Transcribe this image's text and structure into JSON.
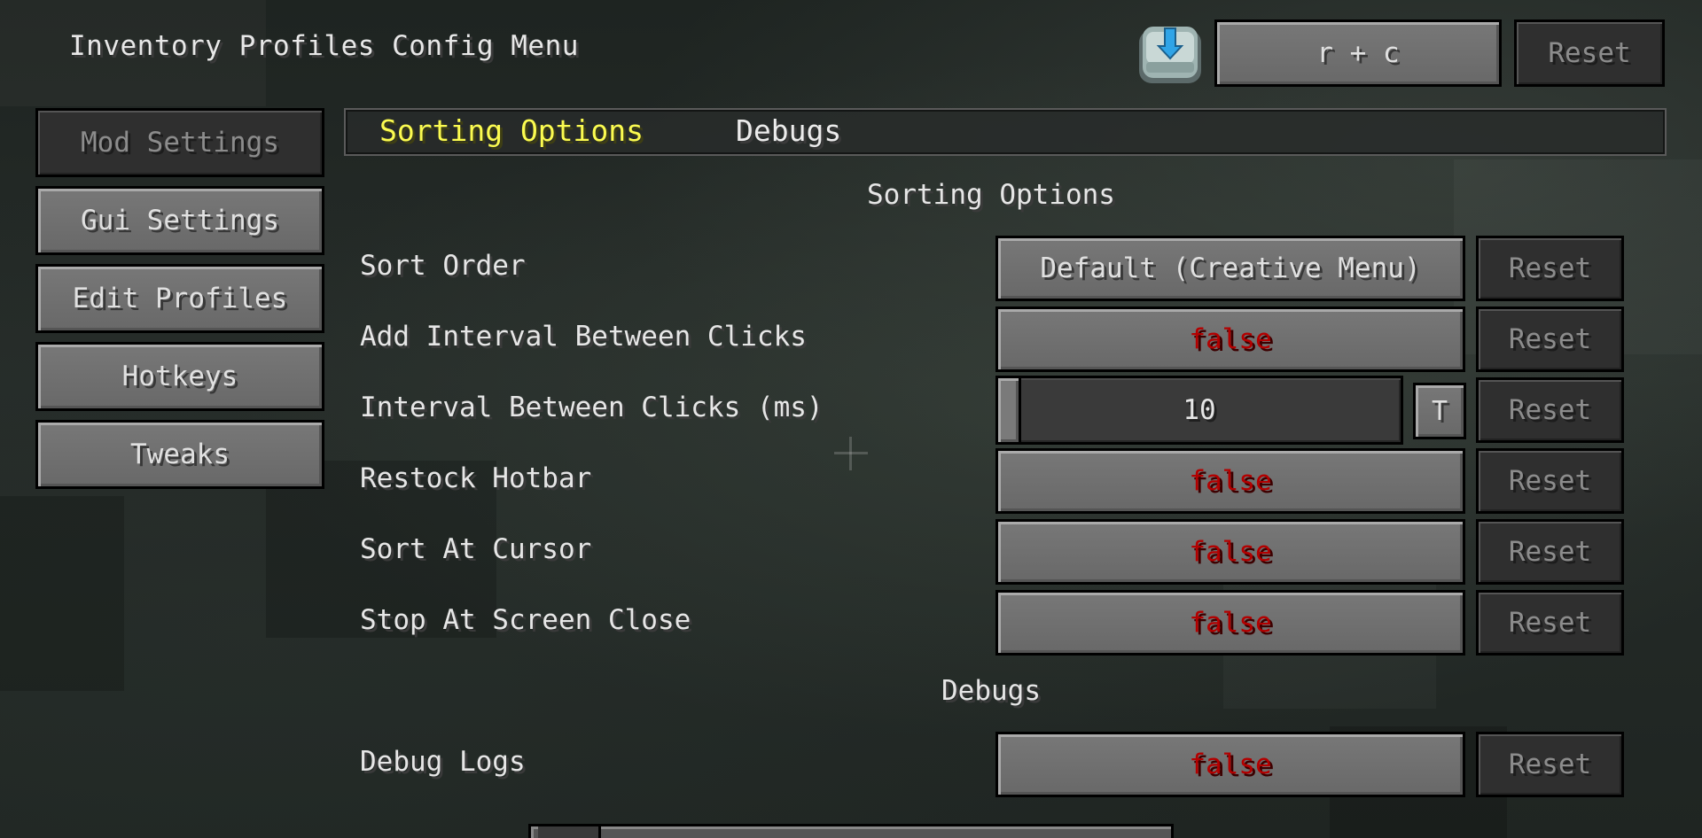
{
  "title": "Inventory Profiles Config Menu",
  "top_right": {
    "hotkey_icon": "keyboard-key-icon",
    "hotkey_value": "r + c",
    "reset_label": "Reset"
  },
  "sidebar": {
    "items": [
      {
        "label": "Mod Settings",
        "state": "disabled"
      },
      {
        "label": "Gui Settings",
        "state": "enabled"
      },
      {
        "label": "Edit Profiles",
        "state": "enabled"
      },
      {
        "label": "Hotkeys",
        "state": "enabled"
      },
      {
        "label": "Tweaks",
        "state": "enabled"
      }
    ]
  },
  "tabs": [
    {
      "label": "Sorting Options",
      "active": true
    },
    {
      "label": "Debugs",
      "active": false
    }
  ],
  "sections": {
    "sorting": {
      "header": "Sorting Options",
      "settings": [
        {
          "label": "Sort Order",
          "value": "Default (Creative Menu)"
        },
        {
          "label": "Add Interval Between Clicks",
          "value": "false"
        },
        {
          "label": "Interval Between Clicks (ms)",
          "value": "10",
          "toggle_label": "T"
        },
        {
          "label": "Restock Hotbar",
          "value": "false"
        },
        {
          "label": "Sort At Cursor",
          "value": "false"
        },
        {
          "label": "Stop At Screen Close",
          "value": "false"
        }
      ]
    },
    "debugs": {
      "header": "Debugs",
      "settings": [
        {
          "label": "Debug Logs",
          "value": "false"
        }
      ]
    }
  },
  "reset_label": "Reset",
  "colors": {
    "false_value": "#b30000",
    "active_tab": "#fbfb50",
    "text": "#e6e6e6"
  }
}
